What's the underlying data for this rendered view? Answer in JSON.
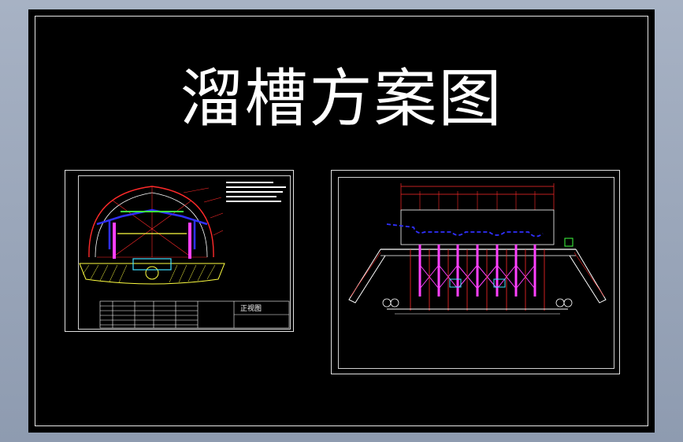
{
  "sheet": {
    "title": "溜槽方案图"
  },
  "left_drawing": {
    "title_block_label": "正视图"
  },
  "colors": {
    "background": "#000000",
    "frame": "#e6e6e6",
    "red": "#ff2a2a",
    "blue": "#3030ff",
    "magenta": "#ff40ff",
    "cyan": "#40e0ff",
    "yellow": "#ffff40",
    "green": "#40ff40"
  }
}
